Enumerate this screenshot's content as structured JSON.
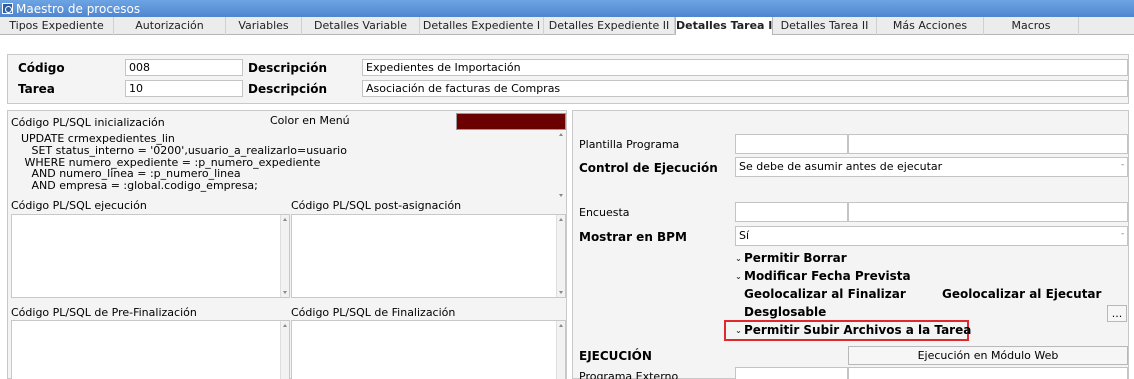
{
  "window": {
    "title": "Maestro de procesos"
  },
  "tabs": [
    {
      "label": "Tipos Expediente"
    },
    {
      "label": "Autorización"
    },
    {
      "label": "Variables"
    },
    {
      "label": "Detalles Variable"
    },
    {
      "label": "Detalles Expediente I"
    },
    {
      "label": "Detalles Expediente II"
    },
    {
      "label": "Detalles Tarea I"
    },
    {
      "label": "Detalles Tarea II"
    },
    {
      "label": "Más Acciones"
    },
    {
      "label": "Macros"
    }
  ],
  "active_tab": "Detalles Tarea I",
  "header": {
    "codigo_label": "Código",
    "codigo_value": "008",
    "descripcion1_label": "Descripción",
    "descripcion1_value": "Expedientes de Importación",
    "tarea_label": "Tarea",
    "tarea_value": "10",
    "descripcion2_label": "Descripción",
    "descripcion2_value": "Asociación de facturas de Compras"
  },
  "left": {
    "init_label": "Código PL/SQL inicialización",
    "color_menu_label": "Color en Menú",
    "color_menu_value": "#6b0000",
    "init_code": [
      "UPDATE crmexpedientes_lin",
      "   SET status_interno = '0200',usuario_a_realizarlo=usuario",
      " WHERE numero_expediente = :p_numero_expediente",
      "   AND numero_linea = :p_numero_linea",
      "   AND empresa = :global.codigo_empresa;"
    ],
    "exec_label": "Código PL/SQL ejecución",
    "post_assign_label": "Código PL/SQL post-asignación",
    "pre_final_label": "Código PL/SQL de Pre-Finalización",
    "final_label": "Código PL/SQL de Finalización"
  },
  "right": {
    "plantilla_label": "Plantilla Programa",
    "control_label": "Control de Ejecución",
    "control_value": "Se debe de asumir antes de ejecutar",
    "encuesta_label": "Encuesta",
    "bpm_label": "Mostrar en BPM",
    "bpm_value": "Sí",
    "checkboxes": {
      "permitir_borrar": "Permitir Borrar",
      "modificar_fecha": "Modificar Fecha Prevista",
      "geo_finalizar": "Geolocalizar al Finalizar",
      "geo_ejecutar": "Geolocalizar al Ejecutar",
      "desglosable": "Desglosable",
      "subir_archivos": "Permitir Subir Archivos a la Tarea"
    },
    "ellipsis_label": "...",
    "ejecucion_label": "EJECUCIÓN",
    "modulo_web_button": "Ejecución en Módulo Web",
    "programa_externo_label": "Programa Externo"
  }
}
